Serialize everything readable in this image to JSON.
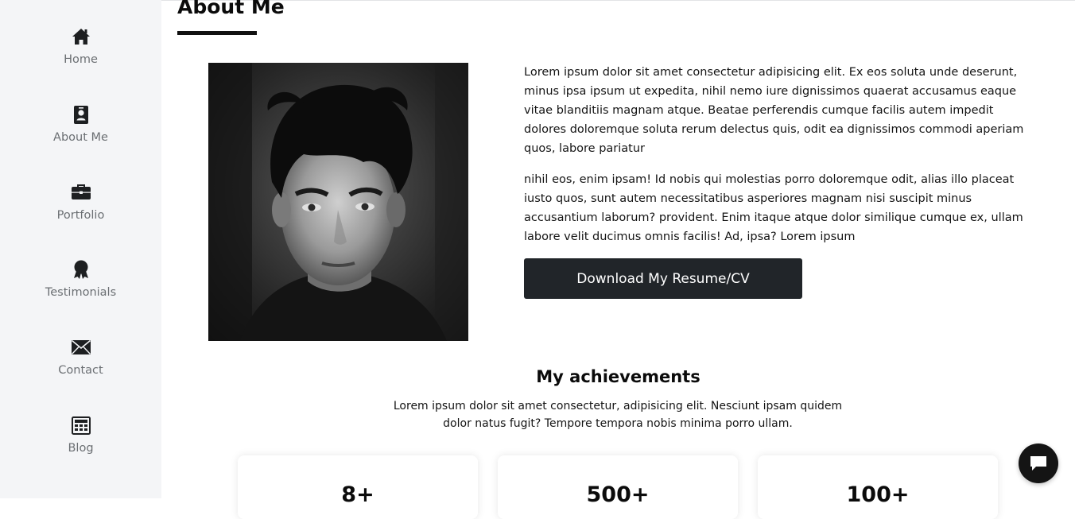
{
  "sidebar": {
    "items": [
      {
        "label": "Home",
        "icon": "home-icon"
      },
      {
        "label": "About Me",
        "icon": "contact-card-icon"
      },
      {
        "label": "Portfolio",
        "icon": "briefcase-icon"
      },
      {
        "label": "Testimonials",
        "icon": "award-icon"
      },
      {
        "label": "Contact",
        "icon": "envelope-icon"
      },
      {
        "label": "Blog",
        "icon": "newspaper-icon"
      }
    ]
  },
  "about": {
    "title": "About Me",
    "paragraph1": "Lorem ipsum dolor sit amet consectetur adipisicing elit. Ex eos soluta unde deserunt, minus ipsa ipsum ut expedita, nihil nemo iure dignissimos quaerat accusamus eaque vitae blanditiis magnam atque. Beatae perferendis cumque facilis autem impedit dolores doloremque soluta rerum delectus quis, odit ea dignissimos commodi aperiam quos, labore pariatur",
    "paragraph2": "nihil eos, enim ipsam! Id nobis qui molestias porro doloremque odit, alias illo placeat iusto quos, sunt autem necessitatibus asperiores magnam nisi suscipit minus accusantium laborum? provident. Enim itaque atque dolor similique cumque ex, ullam labore velit ducimus omnis facilis! Ad, ipsa? Lorem ipsum",
    "resume_button": "Download My Resume/CV"
  },
  "achievements": {
    "title": "My achievements",
    "description": "Lorem ipsum dolor sit amet consectetur, adipisicing elit. Nesciunt ipsam quidem dolor natus fugit? Tempore tempora nobis minima porro ullam.",
    "cards": [
      {
        "value": "8+"
      },
      {
        "value": "500+"
      },
      {
        "value": "100+"
      }
    ]
  },
  "chat": {
    "icon": "chat-bubble-icon"
  },
  "colors": {
    "sidebar_bg": "#f4f5f7",
    "button_bg": "#212529",
    "text": "#141414"
  }
}
